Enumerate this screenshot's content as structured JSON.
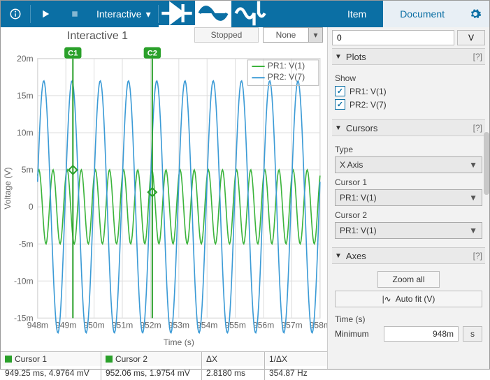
{
  "toolbar": {
    "interactive_label": "Interactive"
  },
  "tabs": {
    "item": "Item",
    "document": "Document"
  },
  "plot": {
    "title": "Interactive 1",
    "status": "Stopped",
    "dropdown": "None",
    "xlabel": "Time (s)",
    "ylabel": "Voltage (V)",
    "legend1": "PR1: V(1)",
    "legend2": "PR2: V(7)",
    "cursor1_tag": "C1",
    "cursor2_tag": "C2"
  },
  "cursor_table": {
    "c1_head": "Cursor 1",
    "c1_val": "949.25 ms, 4.9764 mV",
    "c2_head": "Cursor 2",
    "c2_val": "952.06 ms, 1.9754 mV",
    "dx_head": "ΔX",
    "dx_val": "2.8180 ms",
    "idx_head": "1/ΔX",
    "idx_val": "354.87 Hz"
  },
  "panel": {
    "top_value": "0",
    "top_unit": "V",
    "plots_hdr": "Plots",
    "show_lbl": "Show",
    "chk1": "PR1: V(1)",
    "chk2": "PR2: V(7)",
    "cursors_hdr": "Cursors",
    "type_lbl": "Type",
    "type_val": "X Axis",
    "c1_lbl": "Cursor 1",
    "c1_val": "PR1: V(1)",
    "c2_lbl": "Cursor 2",
    "c2_val": "PR1: V(1)",
    "axes_hdr": "Axes",
    "zoom_btn": "Zoom all",
    "autofit_btn": "Auto fit (V)",
    "time_lbl": "Time (s)",
    "min_lbl": "Minimum",
    "min_val": "948m",
    "min_unit": "s",
    "help": "[?]"
  },
  "chart_data": {
    "type": "line",
    "title": "Interactive 1",
    "xlabel": "Time (s)",
    "ylabel": "Voltage (V)",
    "xlim": [
      0.948,
      0.958
    ],
    "ylim": [
      -0.015,
      0.02
    ],
    "xticks": [
      "948m",
      "949m",
      "950m",
      "951m",
      "952m",
      "953m",
      "954m",
      "955m",
      "956m",
      "957m",
      "958m"
    ],
    "yticks": [
      "-15m",
      "-10m",
      "-5m",
      "0",
      "5m",
      "10m",
      "15m",
      "20m"
    ],
    "series": [
      {
        "name": "PR1: V(1)",
        "color": "#3cb43c",
        "amplitude_mV": 5.0,
        "freq_Hz": 2000,
        "phase_rad": 1.0
      },
      {
        "name": "PR2: V(7)",
        "color": "#3c9bd6",
        "amplitude_mV": 17.0,
        "freq_Hz": 1000,
        "phase_rad": 0.2
      }
    ],
    "cursors": [
      {
        "name": "C1",
        "x_ms": 949.25,
        "y_mV": 4.9764
      },
      {
        "name": "C2",
        "x_ms": 952.06,
        "y_mV": 1.9754
      }
    ],
    "dx_ms": 2.818,
    "inv_dx_Hz": 354.87
  }
}
